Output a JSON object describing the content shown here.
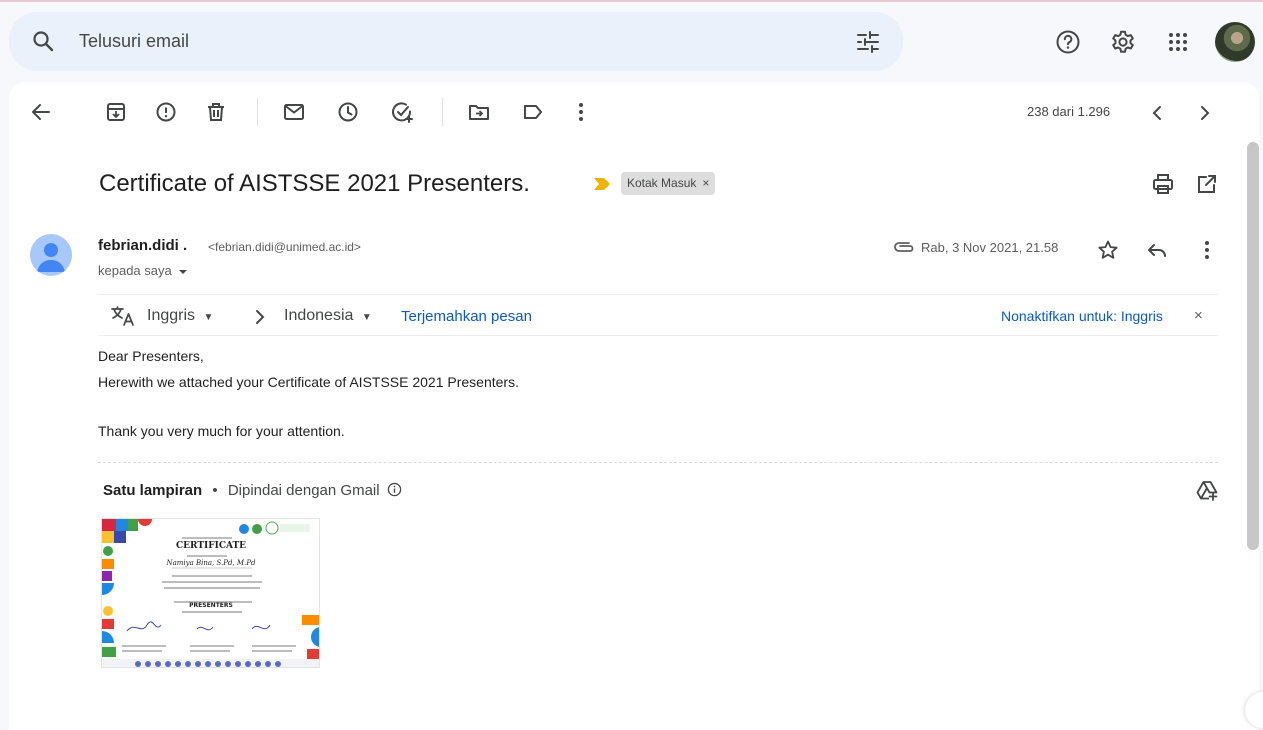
{
  "search": {
    "placeholder": "Telusuri email"
  },
  "pager": {
    "text": "238 dari 1.296"
  },
  "email": {
    "subject": "Certificate of AISTSSE 2021 Presenters.",
    "label": "Kotak Masuk",
    "label_close": "×",
    "sender_name": "febrian.didi .",
    "sender_email": "<febrian.didi@unimed.ac.id>",
    "to": "kepada saya",
    "date": "Rab, 3 Nov 2021, 21.58"
  },
  "translate": {
    "from": "Inggris",
    "to": "Indonesia",
    "translate_link": "Terjemahkan pesan",
    "disable_link": "Nonaktifkan untuk: Inggris",
    "close": "×"
  },
  "body": {
    "line1": "Dear Presenters,",
    "line2": "Herewith we attached your Certificate of AISTSSE 2021 Presenters.",
    "line3": "Thank you very much for your attention."
  },
  "attachment": {
    "count_label": "Satu lampiran",
    "dot": "•",
    "scan_label": "Dipindai dengan Gmail",
    "thumb": {
      "title": "CERTIFICATE",
      "name": "Namiya Bina, S.Pd, M.Pd",
      "section": "PRESENTERS"
    }
  },
  "colors": {
    "accent": "#0b57d0",
    "label_arrow": "#f2b400",
    "search_bg": "#eaf1fb",
    "page_bg": "#f6f8fc"
  }
}
